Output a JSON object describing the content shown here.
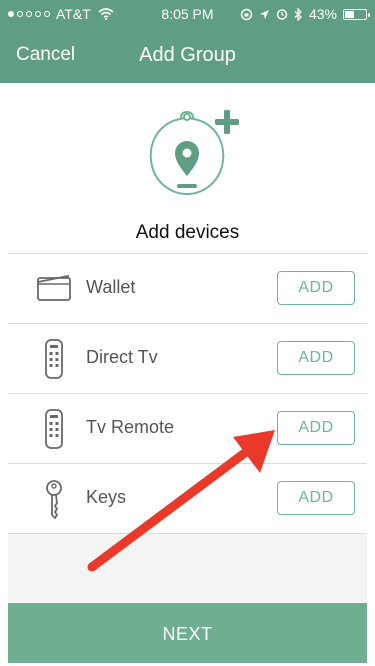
{
  "status_bar": {
    "carrier": "AT&T",
    "time": "8:05 PM",
    "battery": "43%",
    "battery_level": 0.43
  },
  "nav": {
    "cancel_label": "Cancel",
    "title": "Add Group"
  },
  "hero": {
    "label": "Add devices"
  },
  "devices": [
    {
      "label": "Wallet",
      "icon": "wallet-icon",
      "action": "ADD"
    },
    {
      "label": "Direct Tv",
      "icon": "remote-icon",
      "action": "ADD"
    },
    {
      "label": "Tv Remote",
      "icon": "remote-icon",
      "action": "ADD"
    },
    {
      "label": "Keys",
      "icon": "key-icon",
      "action": "ADD"
    }
  ],
  "footer": {
    "next_label": "NEXT"
  },
  "colors": {
    "header_bg": "#5f9e82",
    "accent": "#6fb597",
    "annotation_arrow": "#e8392b"
  }
}
